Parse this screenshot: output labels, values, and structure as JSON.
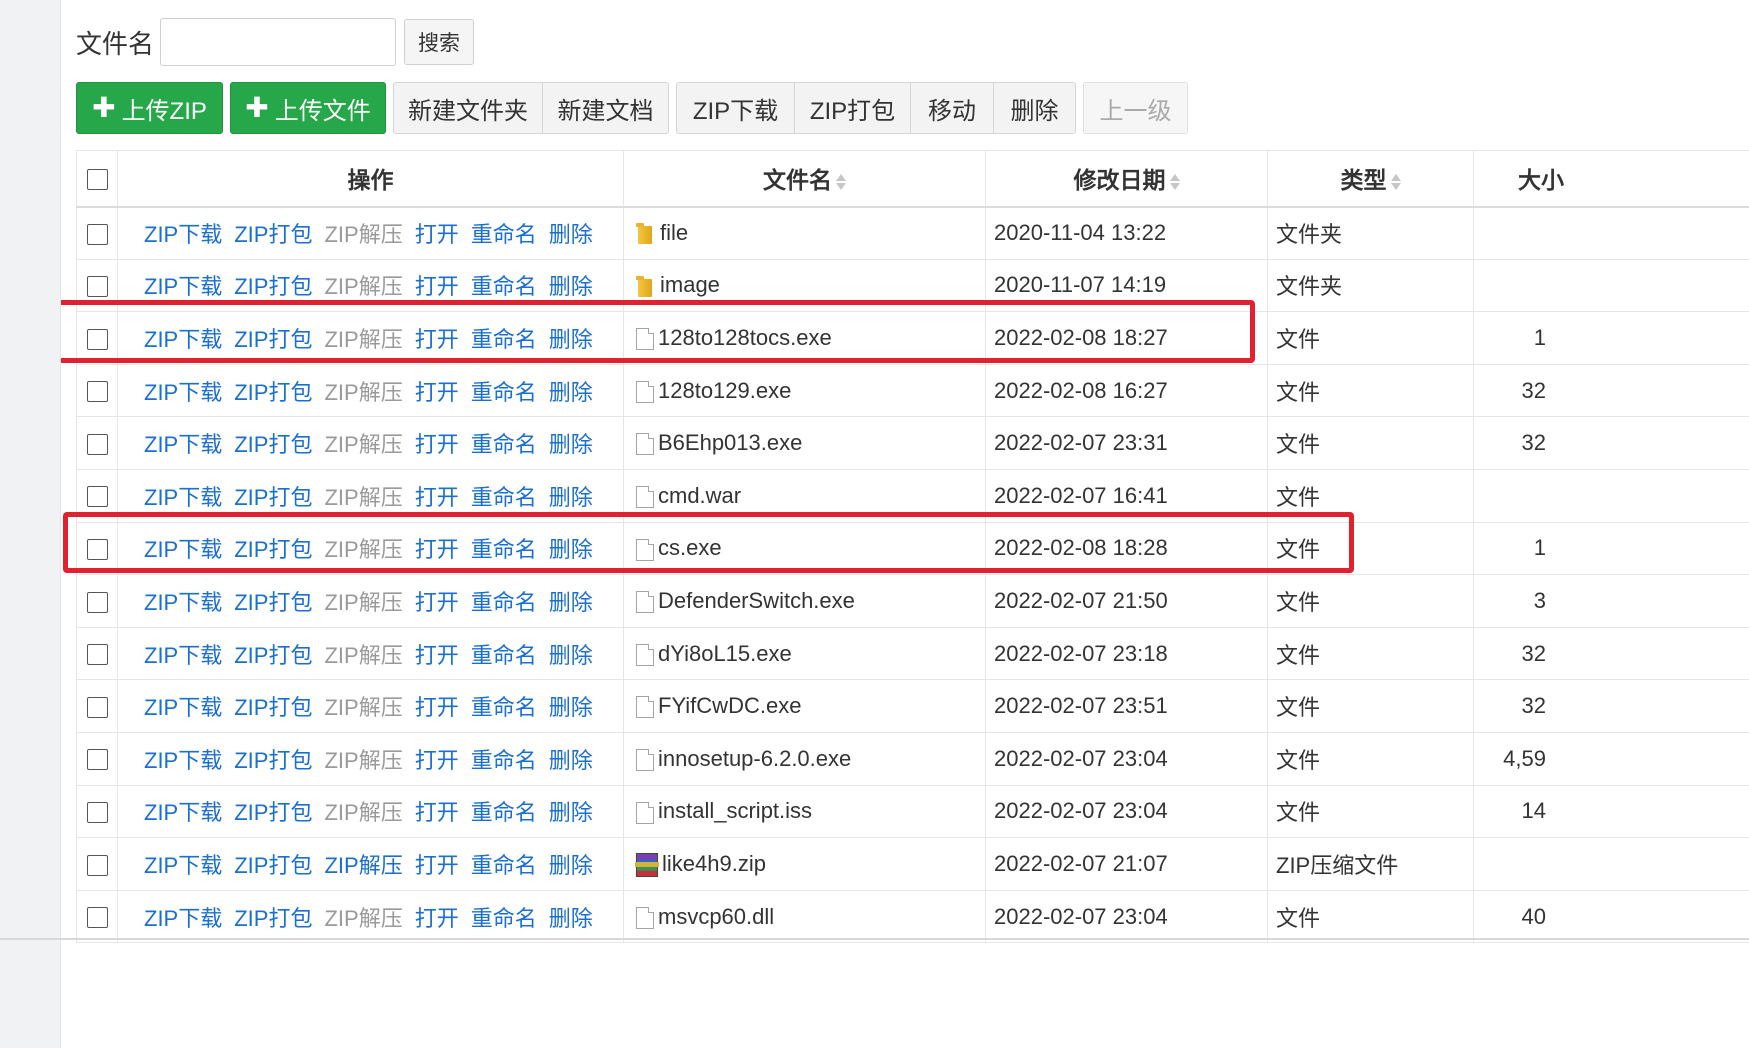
{
  "search": {
    "label": "文件名",
    "value": "",
    "placeholder": "",
    "button": "搜索"
  },
  "toolbar": {
    "upload_zip": "上传ZIP",
    "upload_file": "上传文件",
    "new_folder": "新建文件夹",
    "new_doc": "新建文档",
    "zip_download": "ZIP下载",
    "zip_pack": "ZIP打包",
    "move": "移动",
    "delete": "删除",
    "parent": "上一级"
  },
  "table": {
    "headers": {
      "ops": "操作",
      "name": "文件名",
      "date": "修改日期",
      "type": "类型",
      "size": "大小"
    },
    "actions": [
      "ZIP下载",
      "ZIP打包",
      "ZIP解压",
      "打开",
      "重命名",
      "删除"
    ],
    "rows": [
      {
        "name": "file",
        "date": "2020-11-04 13:22",
        "type": "文件夹",
        "size": "",
        "icon": "folder-icon",
        "unzip_enabled": false
      },
      {
        "name": "image",
        "date": "2020-11-07 14:19",
        "type": "文件夹",
        "size": "",
        "icon": "folder-icon",
        "unzip_enabled": false
      },
      {
        "name": "128to128tocs.exe",
        "date": "2022-02-08 18:27",
        "type": "文件",
        "size": "1",
        "icon": "file-icon",
        "unzip_enabled": false
      },
      {
        "name": "128to129.exe",
        "date": "2022-02-08 16:27",
        "type": "文件",
        "size": "32",
        "icon": "file-icon",
        "unzip_enabled": false
      },
      {
        "name": "B6Ehp013.exe",
        "date": "2022-02-07 23:31",
        "type": "文件",
        "size": "32",
        "icon": "file-icon",
        "unzip_enabled": false
      },
      {
        "name": "cmd.war",
        "date": "2022-02-07 16:41",
        "type": "文件",
        "size": "",
        "icon": "file-icon",
        "unzip_enabled": false
      },
      {
        "name": "cs.exe",
        "date": "2022-02-08 18:28",
        "type": "文件",
        "size": "1",
        "icon": "file-icon",
        "unzip_enabled": false
      },
      {
        "name": "DefenderSwitch.exe",
        "date": "2022-02-07 21:50",
        "type": "文件",
        "size": "3",
        "icon": "file-icon",
        "unzip_enabled": false
      },
      {
        "name": "dYi8oL15.exe",
        "date": "2022-02-07 23:18",
        "type": "文件",
        "size": "32",
        "icon": "file-icon",
        "unzip_enabled": false
      },
      {
        "name": "FYifCwDC.exe",
        "date": "2022-02-07 23:51",
        "type": "文件",
        "size": "32",
        "icon": "file-icon",
        "unzip_enabled": false
      },
      {
        "name": "innosetup-6.2.0.exe",
        "date": "2022-02-07 23:04",
        "type": "文件",
        "size": "4,59",
        "icon": "file-icon",
        "unzip_enabled": false
      },
      {
        "name": "install_script.iss",
        "date": "2022-02-07 23:04",
        "type": "文件",
        "size": "14",
        "icon": "file-icon",
        "unzip_enabled": false
      },
      {
        "name": "like4h9.zip",
        "date": "2022-02-07 21:07",
        "type": "ZIP压缩文件",
        "size": "",
        "icon": "zip-archive-icon",
        "unzip_enabled": true
      },
      {
        "name": "msvcp60.dll",
        "date": "2022-02-07 23:04",
        "type": "文件",
        "size": "40",
        "icon": "file-icon",
        "unzip_enabled": false
      }
    ]
  },
  "colors": {
    "green": "#26a74a",
    "link": "#1a6fd1",
    "disabled": "#9a9a9a",
    "highlight": "#e02130"
  }
}
